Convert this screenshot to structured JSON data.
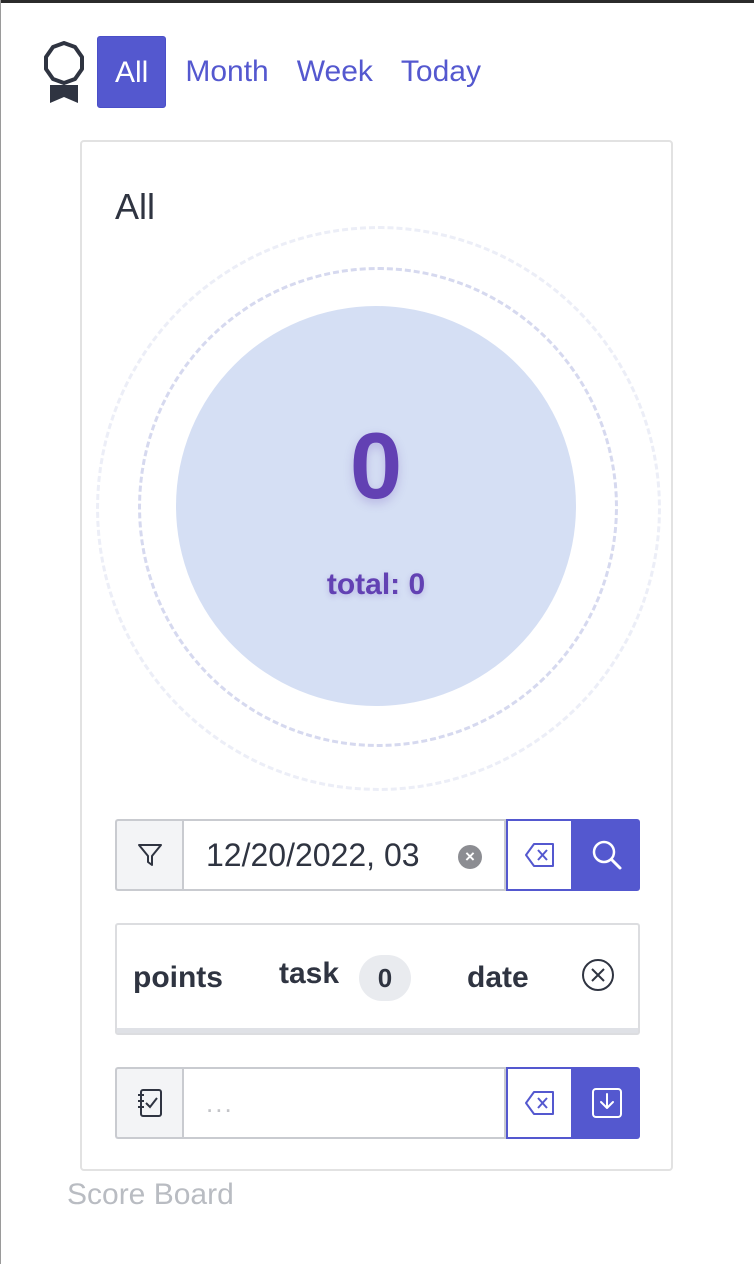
{
  "nav": {
    "logo_icon": "award-badge-icon",
    "tabs": [
      {
        "label": "All",
        "active": true
      },
      {
        "label": "Month",
        "active": false
      },
      {
        "label": "Week",
        "active": false
      },
      {
        "label": "Today",
        "active": false
      }
    ]
  },
  "card": {
    "title": "All",
    "score": "0",
    "total_label": "total: 0"
  },
  "filter": {
    "icon": "filter-icon",
    "value": "12/20/2022, 03",
    "clear_icon": "backspace-icon",
    "search_icon": "search-icon"
  },
  "table": {
    "col_points": "points",
    "col_task": "task",
    "task_count": "0",
    "col_date": "date",
    "close_icon": "close-circle-icon"
  },
  "entry": {
    "icon": "task-check-icon",
    "placeholder": "...",
    "clear_icon": "backspace-icon",
    "save_icon": "download-icon"
  },
  "footer": {
    "label": "Score Board"
  },
  "colors": {
    "accent": "#5458cf",
    "score": "#6241b3",
    "circle": "#d5dff4"
  }
}
